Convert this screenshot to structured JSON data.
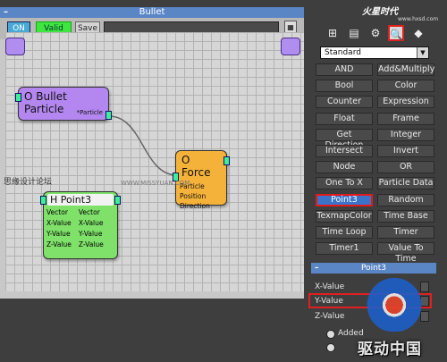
{
  "editor": {
    "title": "Bullet",
    "toolbar": {
      "on_label": "ON",
      "valid_label": "Valid",
      "save_label": "Save"
    },
    "nodes": {
      "bullet": {
        "title": "O Bullet Particle",
        "output": "*Particle"
      },
      "force": {
        "title": "O Force",
        "inputs": [
          "Particle",
          "Position",
          "Direction"
        ]
      },
      "point3": {
        "title": "H Point3",
        "inputs": [
          "Vector",
          "X-Value",
          "Y-Value",
          "Z-Value"
        ],
        "outputs": [
          "Vector",
          "X-Value",
          "Y-Value",
          "Z-Value"
        ]
      }
    },
    "watermark_left": "思缘设计论坛",
    "watermark_url": "WWW.MISSYUAN.COM"
  },
  "right_panel": {
    "watermark_top": "火星时代",
    "watermark_site": "www.hxsd.com",
    "dropdown_value": "Standard",
    "operators": [
      [
        "AND",
        "Add&Multiply"
      ],
      [
        "Bool",
        "Color"
      ],
      [
        "Counter",
        "Expression"
      ],
      [
        "Float",
        "Frame"
      ],
      [
        "Get Direction",
        "Integer"
      ],
      [
        "Intersect",
        "Invert"
      ],
      [
        "Node",
        "OR"
      ],
      [
        "One To X",
        "Particle Data"
      ],
      [
        "Point3",
        "Random"
      ],
      [
        "TexmapColor",
        "Time Base"
      ],
      [
        "Time Loop",
        "Timer"
      ],
      [
        "Timer1",
        "Value To Time"
      ]
    ],
    "selected_operator": "Point3",
    "point3_panel": {
      "title": "Point3",
      "fields": [
        "X-Value",
        "Y-Value",
        "Z-Value"
      ],
      "radio_label": "Added"
    },
    "logo_text": "驱动中国"
  },
  "colors": {
    "accent": "#5a86c6",
    "highlight": "#e31a1a",
    "valid": "#3fe63f"
  }
}
